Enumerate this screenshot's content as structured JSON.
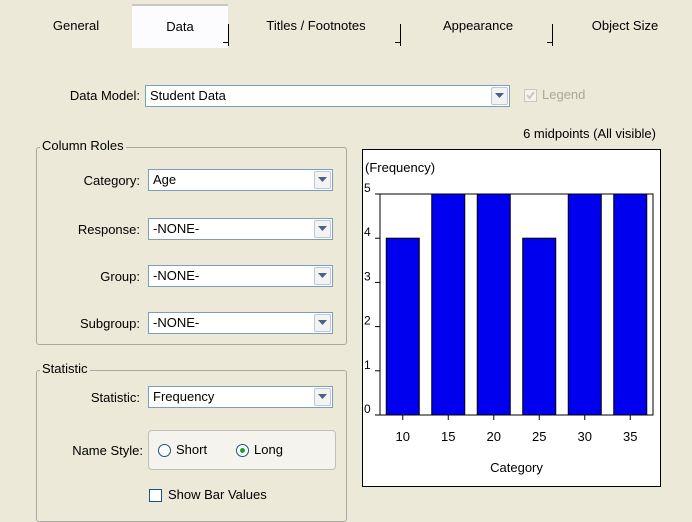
{
  "tabs": [
    {
      "label": "General"
    },
    {
      "label": "Data"
    },
    {
      "label": "Titles / Footnotes"
    },
    {
      "label": "Appearance"
    },
    {
      "label": "Object Size"
    }
  ],
  "data_model": {
    "label": "Data Model:",
    "value": "Student Data",
    "legend_label": "Legend",
    "legend_checked": true
  },
  "column_roles": {
    "title": "Column Roles",
    "category": {
      "label": "Category:",
      "value": "Age"
    },
    "response": {
      "label": "Response:",
      "value": "-NONE-"
    },
    "group": {
      "label": "Group:",
      "value": "-NONE-"
    },
    "subgroup": {
      "label": "Subgroup:",
      "value": "-NONE-"
    }
  },
  "statistic": {
    "title": "Statistic",
    "statistic_label": "Statistic:",
    "statistic_value": "Frequency",
    "name_style_label": "Name Style:",
    "short_label": "Short",
    "long_label": "Long",
    "selected": "long",
    "show_bar_values_label": "Show Bar Values"
  },
  "midpoints_text": "6 midpoints (All visible)",
  "chart_data": {
    "type": "bar",
    "ylabel": "(Frequency)",
    "xlabel": "Category",
    "categories": [
      "10",
      "15",
      "20",
      "25",
      "30",
      "35"
    ],
    "values": [
      4,
      5,
      5,
      4,
      5,
      5
    ],
    "yticks": [
      "0",
      "1",
      "2",
      "3",
      "4",
      "5"
    ],
    "ylim": [
      0,
      5
    ],
    "bar_color": "#0000ee"
  }
}
